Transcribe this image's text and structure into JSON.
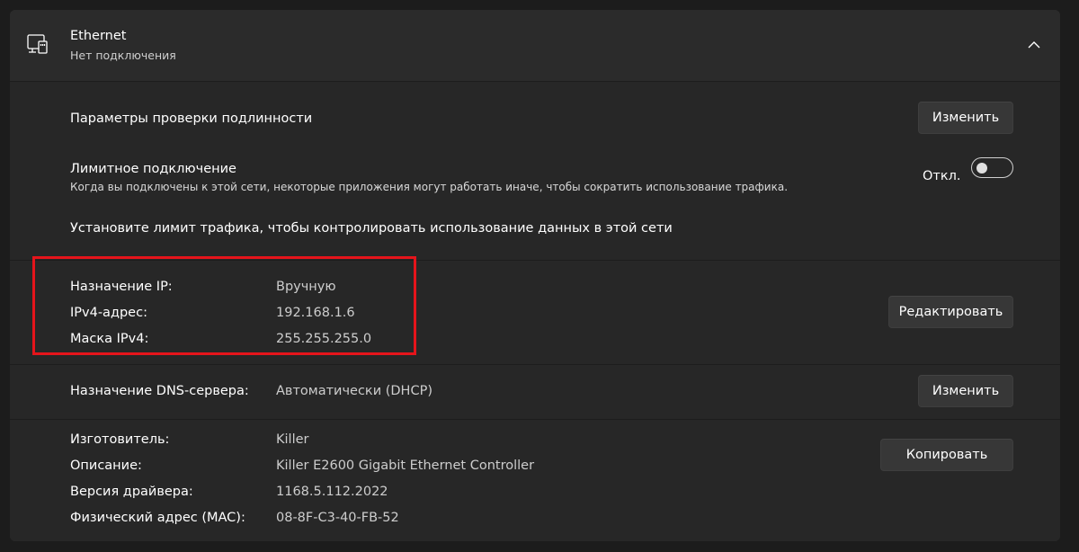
{
  "header": {
    "title": "Ethernet",
    "subtitle": "Нет подключения"
  },
  "auth": {
    "label": "Параметры проверки подлинности",
    "button": "Изменить"
  },
  "metered": {
    "title": "Лимитное подключение",
    "description": "Когда вы подключены к этой сети, некоторые приложения могут работать иначе, чтобы сократить использование трафика.",
    "toggle_label": "Откл.",
    "toggle_on": false,
    "limit_link": "Установите лимит трафика, чтобы контролировать использование данных в этой сети"
  },
  "ip": {
    "rows": [
      {
        "label": "Назначение IP:",
        "value": "Вручную"
      },
      {
        "label": "IPv4-адрес:",
        "value": "192.168.1.6"
      },
      {
        "label": "Маска IPv4:",
        "value": "255.255.255.0"
      }
    ],
    "button": "Редактировать"
  },
  "dns": {
    "label": "Назначение DNS-сервера:",
    "value": "Автоматически (DHCP)",
    "button": "Изменить"
  },
  "properties": {
    "rows": [
      {
        "label": "Изготовитель:",
        "value": "Killer"
      },
      {
        "label": "Описание:",
        "value": "Killer E2600 Gigabit Ethernet Controller"
      },
      {
        "label": "Версия драйвера:",
        "value": "1168.5.112.2022"
      },
      {
        "label": "Физический адрес (MAC):",
        "value": "08-8F-C3-40-FB-52"
      }
    ],
    "button": "Копировать"
  },
  "colors": {
    "background": "#1c1c1c",
    "card": "#2b2b2b",
    "section": "#272727",
    "highlight": "#e5141b"
  },
  "icons": [
    "ethernet-icon",
    "chevron-up-icon"
  ]
}
